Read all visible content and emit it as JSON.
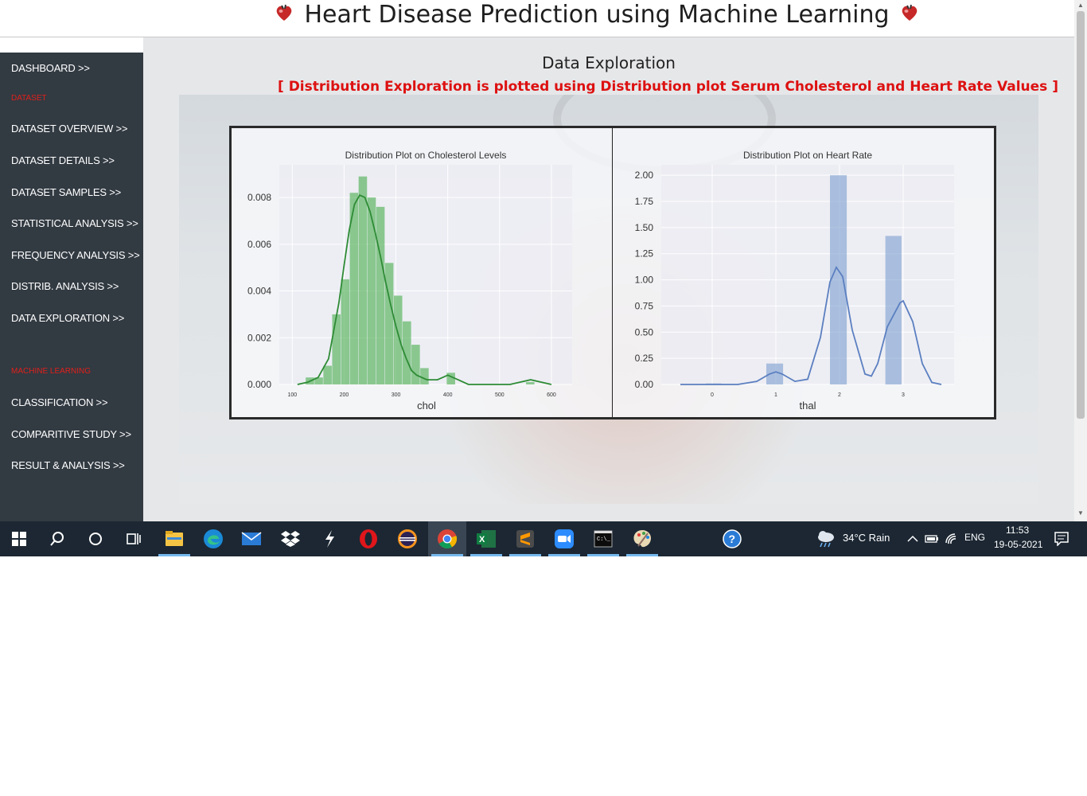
{
  "header": {
    "title": "Heart Disease Prediction using Machine Learning"
  },
  "sidebar": {
    "items": [
      {
        "label": "DASHBOARD >>",
        "type": "link"
      },
      {
        "label": "DATASET",
        "type": "section"
      },
      {
        "label": "DATASET OVERVIEW >>",
        "type": "link"
      },
      {
        "label": "DATASET DETAILS >>",
        "type": "link"
      },
      {
        "label": "DATASET SAMPLES >>",
        "type": "link"
      },
      {
        "label": "STATISTICAL ANALYSIS >>",
        "type": "link"
      },
      {
        "label": "FREQUENCY ANALYSIS >>",
        "type": "link"
      },
      {
        "label": "DISTRIB. ANALYSIS >>",
        "type": "link"
      },
      {
        "label": "DATA EXPLORATION >>",
        "type": "link"
      },
      {
        "label": "MACHINE LEARNING",
        "type": "section"
      },
      {
        "label": "CLASSIFICATION >>",
        "type": "link"
      },
      {
        "label": "COMPARITIVE STUDY >>",
        "type": "link"
      },
      {
        "label": "RESULT & ANALYSIS >>",
        "type": "link"
      }
    ]
  },
  "main": {
    "title": "Data Exploration",
    "subtitle": "[ Distribution Exploration is plotted using Distribution plot Serum Cholesterol and Heart Rate Values ]"
  },
  "colors": {
    "sidebar_bg": "#323a42",
    "section_label": "#e0201a",
    "subtitle": "#dd1111",
    "hist_green": "#4caf50",
    "kde_green": "#2e8b35",
    "hist_blue": "#7f9fd0",
    "kde_blue": "#5b7fc0"
  },
  "chart_data": [
    {
      "type": "bar",
      "title": "Distribution Plot on Cholesterol Levels",
      "xlabel": "chol",
      "ylabel": "",
      "xlim": [
        75,
        640
      ],
      "ylim": [
        0,
        0.0094
      ],
      "x_ticks": [
        100,
        200,
        300,
        400,
        500,
        600
      ],
      "y_ticks": [
        0.0,
        0.002,
        0.004,
        0.006,
        0.008
      ],
      "y_tick_labels": [
        "0.000",
        "0.002",
        "0.004",
        "0.006",
        "0.008"
      ],
      "bins": [
        {
          "x0": 126,
          "x1": 143,
          "value": 0.0003
        },
        {
          "x0": 143,
          "x1": 160,
          "value": 0.0003
        },
        {
          "x0": 160,
          "x1": 177,
          "value": 0.0008
        },
        {
          "x0": 177,
          "x1": 194,
          "value": 0.003
        },
        {
          "x0": 194,
          "x1": 211,
          "value": 0.0045
        },
        {
          "x0": 211,
          "x1": 228,
          "value": 0.0082
        },
        {
          "x0": 228,
          "x1": 245,
          "value": 0.0089
        },
        {
          "x0": 245,
          "x1": 262,
          "value": 0.008
        },
        {
          "x0": 262,
          "x1": 279,
          "value": 0.0076
        },
        {
          "x0": 279,
          "x1": 296,
          "value": 0.0052
        },
        {
          "x0": 296,
          "x1": 313,
          "value": 0.0038
        },
        {
          "x0": 313,
          "x1": 330,
          "value": 0.0027
        },
        {
          "x0": 330,
          "x1": 347,
          "value": 0.0017
        },
        {
          "x0": 347,
          "x1": 364,
          "value": 0.0007
        },
        {
          "x0": 398,
          "x1": 415,
          "value": 0.0005
        },
        {
          "x0": 551,
          "x1": 568,
          "value": 0.0001
        }
      ],
      "kde": {
        "x": [
          110,
          130,
          150,
          170,
          190,
          200,
          210,
          220,
          230,
          240,
          250,
          260,
          270,
          280,
          290,
          300,
          310,
          320,
          330,
          340,
          360,
          380,
          400,
          420,
          440,
          480,
          520,
          560,
          600
        ],
        "y": [
          0.0,
          0.0001,
          0.0003,
          0.0011,
          0.0035,
          0.0051,
          0.0066,
          0.0077,
          0.0081,
          0.008,
          0.0074,
          0.0065,
          0.0055,
          0.0044,
          0.0034,
          0.0025,
          0.0017,
          0.0011,
          0.0006,
          0.0004,
          0.0002,
          0.0002,
          0.0004,
          0.0002,
          0.0,
          0.0,
          0.0,
          0.0002,
          0.0
        ]
      },
      "grid": true
    },
    {
      "type": "bar",
      "title": "Distribution Plot on Heart Rate",
      "xlabel": "thal",
      "ylabel": "",
      "xlim": [
        -0.8,
        3.8
      ],
      "ylim": [
        0,
        2.1
      ],
      "x_ticks": [
        0,
        1,
        2,
        3
      ],
      "y_ticks": [
        0.0,
        0.25,
        0.5,
        0.75,
        1.0,
        1.25,
        1.5,
        1.75,
        2.0
      ],
      "y_tick_labels": [
        "0.00",
        "0.25",
        "0.50",
        "0.75",
        "1.00",
        "1.25",
        "1.50",
        "1.75",
        "2.00"
      ],
      "bins": [
        {
          "x0": -0.1,
          "x1": 0.15,
          "value": 0.01
        },
        {
          "x0": 0.85,
          "x1": 1.12,
          "value": 0.2
        },
        {
          "x0": 1.85,
          "x1": 2.12,
          "value": 2.0
        },
        {
          "x0": 2.72,
          "x1": 2.98,
          "value": 1.42
        }
      ],
      "kde": {
        "x": [
          -0.5,
          0.0,
          0.4,
          0.7,
          0.9,
          1.0,
          1.1,
          1.3,
          1.5,
          1.7,
          1.85,
          1.95,
          2.05,
          2.2,
          2.4,
          2.5,
          2.6,
          2.75,
          2.95,
          3.0,
          3.15,
          3.3,
          3.45,
          3.6
        ],
        "y": [
          0.0,
          0.0,
          0.0,
          0.03,
          0.1,
          0.12,
          0.1,
          0.03,
          0.05,
          0.45,
          0.98,
          1.12,
          1.03,
          0.52,
          0.1,
          0.08,
          0.2,
          0.55,
          0.78,
          0.8,
          0.6,
          0.2,
          0.02,
          0.0
        ]
      },
      "grid": true
    }
  ],
  "taskbar": {
    "icons": [
      "windows-start-icon",
      "search-icon",
      "cortana-icon",
      "task-view-icon",
      "file-explorer-icon",
      "edge-icon",
      "mail-icon",
      "dropbox-icon",
      "app-icon",
      "opera-icon",
      "eclipse-icon",
      "chrome-icon",
      "excel-icon",
      "sublime-text-icon",
      "zoom-icon",
      "terminal-icon",
      "paint-icon",
      "help-icon"
    ],
    "weather": "34°C  Rain",
    "language": "ENG",
    "time": "11:53",
    "date": "19-05-2021"
  }
}
